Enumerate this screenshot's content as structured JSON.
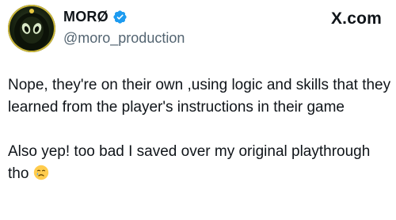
{
  "author": {
    "display_name": "MORØ",
    "handle": "@moro_production",
    "verified": true
  },
  "source_label": "X.com",
  "tweet": {
    "paragraph_1": "Nope, they're on their own ,using logic and skills that they learned from the player's instructions in their game",
    "paragraph_2": "Also yep! too bad I saved over my original playthrough tho",
    "emoji": "sad-but-relieved-face"
  },
  "colors": {
    "verified_blue": "#1d9bf0",
    "handle_gray": "#536471",
    "text": "#0f1419"
  }
}
